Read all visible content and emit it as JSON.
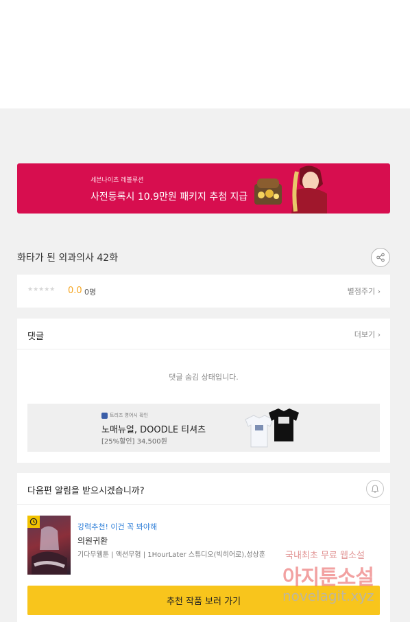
{
  "banner": {
    "subtitle": "세븐나이츠 레볼루션",
    "title": "사전등록시 10.9만원 패키지 추첨 지급",
    "background": "#d70e4f"
  },
  "episode": {
    "title": "화타가 된 외과의사 42화",
    "share_icon": "share-icon"
  },
  "rating": {
    "stars": "★★★★★",
    "score": "0.0",
    "count": "0명",
    "rate_link": "별점주기 ›",
    "score_color": "#f5a623"
  },
  "comments": {
    "title": "댓글",
    "more_link": "더보기 ›",
    "hidden_message": "댓글 숨김 상태입니다."
  },
  "ad": {
    "brand": "트리즈 영어시 확인",
    "title": "노매뉴얼, DOODLE 티셔츠",
    "price": "[25%할인] 34,500원"
  },
  "notify": {
    "title": "다음편 알림을 받으시겠습니까?",
    "bell_icon": "bell-icon"
  },
  "recommendation": {
    "tag": "강력추천! 이건 꼭 봐야해",
    "name": "의원귀환",
    "meta": "기다무웹툰 | 액션무협 | 1HourLater 스튜디오(빅히어로),성상훈",
    "tag_color": "#2f7fd8",
    "cta": "추천 작품 보러 가기",
    "cta_color": "#f8c51c"
  },
  "watermark": {
    "line1": "국내최초 무료 웹소설",
    "line2": "아지툰소설",
    "line3": "novelagit.xyz"
  }
}
